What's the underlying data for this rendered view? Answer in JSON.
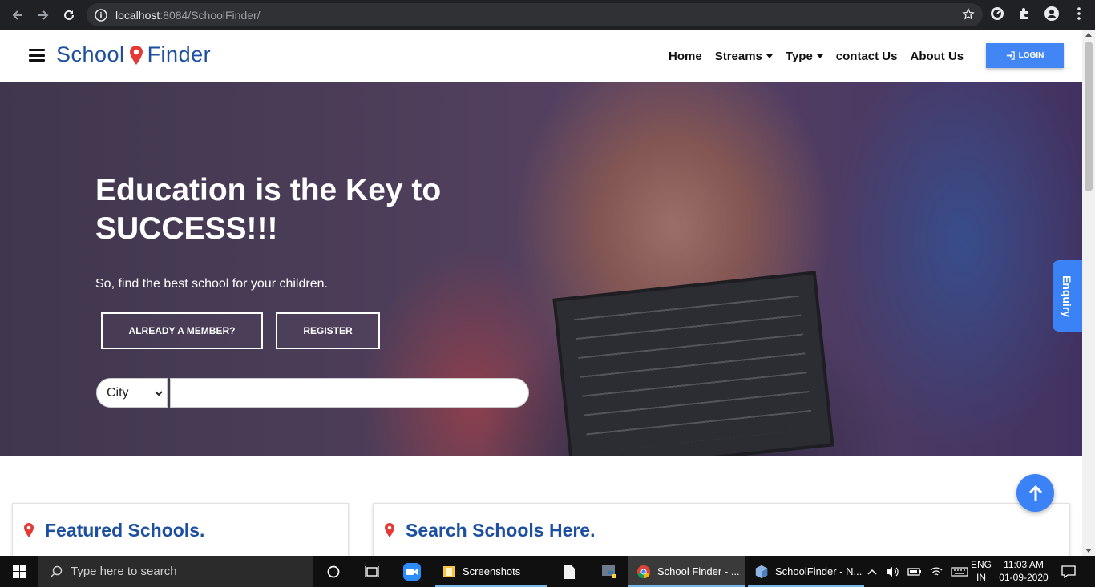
{
  "browser": {
    "url_host": "localhost",
    "url_rest": ":8084/SchoolFinder/"
  },
  "header": {
    "logo_left": "School",
    "logo_right": "Finder",
    "menu": [
      {
        "label": "Home"
      },
      {
        "label": "Streams"
      },
      {
        "label": "Type"
      },
      {
        "label": "contact Us"
      },
      {
        "label": "About Us"
      }
    ],
    "login_label": "LOGIN"
  },
  "hero": {
    "title": "Education is the Key to SUCCESS!!!",
    "subtitle": "So, find the best school for your children.",
    "member_button": "ALREADY A MEMBER?",
    "register_button": "REGISTER",
    "city_select": "City",
    "search_value": ""
  },
  "enquiry_label": "Enquiry",
  "sections": {
    "featured_title": "Featured Schools.",
    "search_title": "Search Schools Here."
  },
  "taskbar": {
    "search_placeholder": "Type here to search",
    "apps": [
      {
        "label": "Screenshots"
      },
      {
        "label": "School Finder - ..."
      },
      {
        "label": "SchoolFinder - N..."
      }
    ],
    "lang_line1": "ENG",
    "lang_line2": "IN",
    "time": "11:03 AM",
    "date": "01-09-2020"
  },
  "colors": {
    "brand": "#1d4fa0",
    "accent": "#4285f4",
    "pin": "#e53935"
  }
}
